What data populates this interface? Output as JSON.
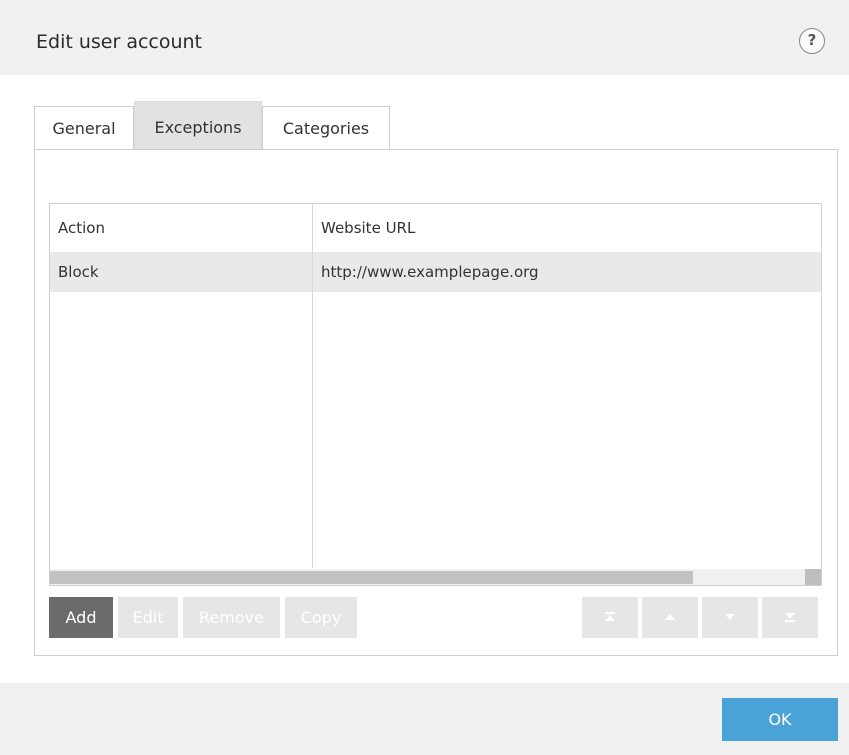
{
  "dialog": {
    "title": "Edit user account",
    "help_symbol": "?"
  },
  "tabs": [
    {
      "label": "General",
      "active": false
    },
    {
      "label": "Exceptions",
      "active": true
    },
    {
      "label": "Categories",
      "active": false
    }
  ],
  "table": {
    "columns": [
      "Action",
      "Website URL"
    ],
    "rows": [
      {
        "action": "Block",
        "url": "http://www.examplepage.org",
        "selected": true
      }
    ]
  },
  "buttons": {
    "add": "Add",
    "edit": "Edit",
    "remove": "Remove",
    "copy": "Copy"
  },
  "move_buttons": {
    "top": "move-to-top-icon",
    "up": "move-up-icon",
    "down": "move-down-icon",
    "bottom": "move-to-bottom-icon"
  },
  "footer": {
    "ok": "OK"
  },
  "colors": {
    "primary_button": "#6b6b6b",
    "ok_button": "#4aa3d6",
    "selected_row": "#e9e9e9"
  }
}
